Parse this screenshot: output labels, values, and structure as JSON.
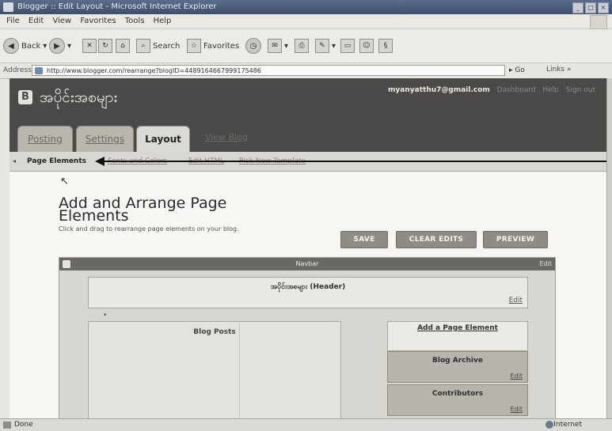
{
  "window": {
    "title": "Blogger :: Edit Layout - Microsoft Internet Explorer",
    "menu": [
      "File",
      "Edit",
      "View",
      "Favorites",
      "Tools",
      "Help"
    ]
  },
  "toolbar": {
    "back": "Back",
    "search": "Search",
    "favorites": "Favorites"
  },
  "address": {
    "label": "Address",
    "url": "http://www.blogger.com/rearrange?blogID=4489164667999175486",
    "go": "Go",
    "links": "Links"
  },
  "blog": {
    "logo": "B",
    "name": "အပိုင်းအစများ",
    "user_email": "myanyatthu7@gmail.com",
    "dashboard": "Dashboard",
    "help": "Help",
    "sign_out": "Sign out"
  },
  "tabs": {
    "posting": "Posting",
    "settings": "Settings",
    "layout": "Layout",
    "view_blog": "View Blog"
  },
  "subtabs": {
    "page_elements": "Page Elements",
    "fonts_colors": "Fonts and Colors",
    "edit_html": "Edit HTML",
    "pick_template": "Pick New Template"
  },
  "main": {
    "heading": "Add and Arrange Page Elements",
    "description": "Click and drag to rearrange page elements on your blog.",
    "save": "SAVE",
    "clear_edits": "CLEAR EDITS",
    "preview": "PREVIEW"
  },
  "layout": {
    "navbar_label": "Navbar",
    "navbar_edit": "Edit",
    "header_title": "အပိုင်းအစများ (Header)",
    "header_edit": "Edit",
    "blog_posts": "Blog Posts",
    "add_element": "Add a Page Element",
    "sidebar": [
      {
        "title": "Blog Archive",
        "edit": "Edit"
      },
      {
        "title": "Contributors",
        "edit": "Edit"
      }
    ]
  },
  "status": {
    "left": "Done",
    "zone": "Internet"
  }
}
